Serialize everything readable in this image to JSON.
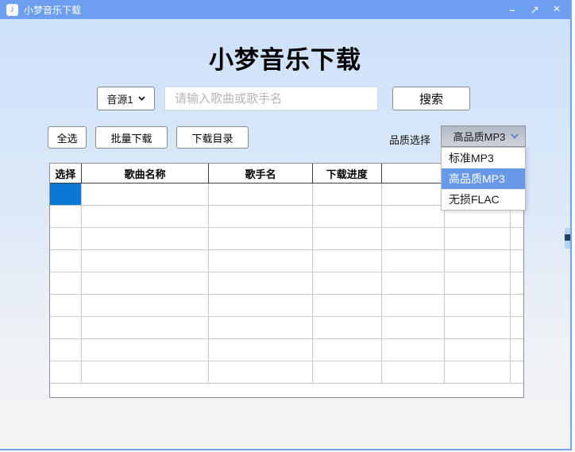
{
  "titlebar": {
    "icon_glyph": "♪",
    "title": "小梦音乐下载",
    "minimize_glyph": "–",
    "maximize_glyph": "↗",
    "close_glyph": "×"
  },
  "header": {
    "app_title": "小梦音乐下载"
  },
  "search": {
    "source_value": "音源1",
    "input_value": "",
    "input_placeholder": "请输入歌曲或歌手名",
    "search_button": "搜索"
  },
  "toolbar": {
    "select_all": "全选",
    "batch_download": "批量下载",
    "download_dir": "下载目录",
    "quality_label": "品质选择",
    "quality_value": "高品质MP3",
    "quality_options": [
      "标准MP3",
      "高品质MP3",
      "无损FLAC"
    ]
  },
  "table": {
    "columns": [
      "选择",
      "歌曲名称",
      "歌手名",
      "下载进度",
      "",
      "",
      ""
    ],
    "row_count": 9,
    "selected_cell": {
      "row": 0,
      "col": 0
    }
  },
  "colors": {
    "titlebar": "#6d9eef",
    "window_border": "#6fa6e9",
    "selection_blue": "#0b79d4",
    "dropdown_highlight": "#6899e8",
    "bg_top": "#cee1fb",
    "bg_bottom": "#f4f4f5"
  }
}
